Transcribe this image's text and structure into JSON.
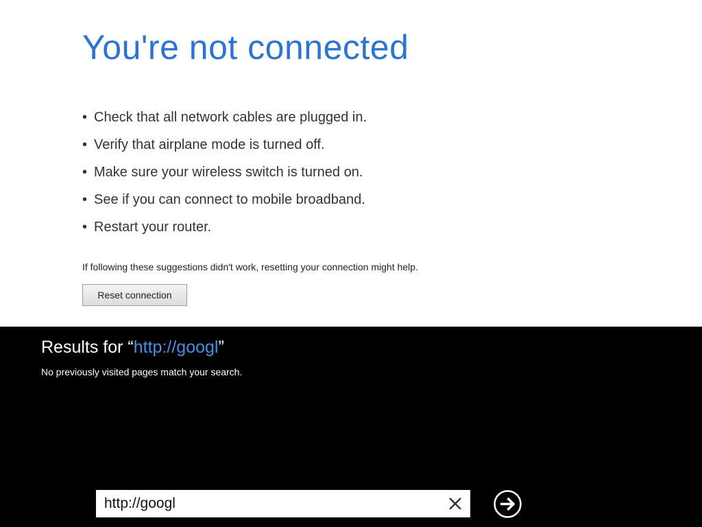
{
  "error_page": {
    "title": "You're not connected",
    "bullet_symbol": "•",
    "suggestions": [
      "Check that all network cables are plugged in.",
      "Verify that airplane mode is turned off.",
      "Make sure your wireless switch is turned on.",
      "See if you can connect to mobile broadband.",
      "Restart your router."
    ],
    "help_text": "If following these suggestions didn't work, resetting your connection might help.",
    "reset_button_label": "Reset connection",
    "title_color": "#2b74d4"
  },
  "results_panel": {
    "heading_prefix": "Results for “",
    "query": "http://googl",
    "heading_suffix": "”",
    "no_match_text": "No previously visited pages match your search.",
    "query_color": "#4a8fe7"
  },
  "address_bar": {
    "value": "http://googl",
    "clear_icon": "close-icon",
    "go_icon": "arrow-right-circle-icon"
  }
}
